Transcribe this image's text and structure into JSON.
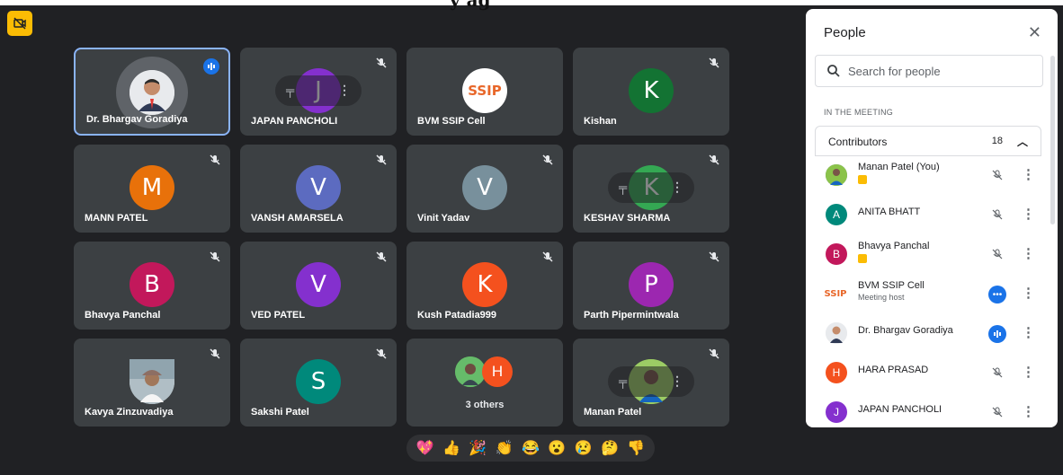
{
  "header_partial_text": "y ag",
  "tiles": [
    {
      "name": "Dr. Bhargav Goradiya"
    },
    {
      "name": "JAPAN PANCHOLI",
      "initial": "J",
      "color": "#8430ce"
    },
    {
      "name": "BVM SSIP Cell",
      "logo_text": "SSIP"
    },
    {
      "name": "Kishan",
      "initial": "K",
      "color": "#137333"
    },
    {
      "name": "MANN PATEL",
      "initial": "M",
      "color": "#e8710a"
    },
    {
      "name": "VANSH AMARSELA",
      "initial": "V",
      "color": "#5c6bc0"
    },
    {
      "name": "Vinit Yadav",
      "initial": "V",
      "color": "#78909c"
    },
    {
      "name": "KESHAV SHARMA",
      "initial": "K",
      "color": "#34a853"
    },
    {
      "name": "Bhavya Panchal",
      "initial": "B",
      "color": "#c2185b"
    },
    {
      "name": "VED PATEL",
      "initial": "V",
      "color": "#8430ce"
    },
    {
      "name": "Kush Patadia999",
      "initial": "K",
      "color": "#f4511e"
    },
    {
      "name": "Parth Pipermintwala",
      "initial": "P",
      "color": "#9c27b0"
    },
    {
      "name": "Kavya Zinzuvadiya"
    },
    {
      "name": "Sakshi Patel",
      "initial": "S",
      "color": "#00897b"
    },
    {
      "name": "3 others",
      "initial": "H",
      "color": "#f4511e"
    },
    {
      "name": "Manan Patel"
    }
  ],
  "reactions": [
    "💖",
    "👍",
    "🎉",
    "👏",
    "😂",
    "😮",
    "😢",
    "🤔",
    "👎"
  ],
  "panel": {
    "title": "People",
    "close": "✕",
    "search_placeholder": "Search for people",
    "section_label": "IN THE MEETING",
    "contributors_label": "Contributors",
    "contributors_count": "18",
    "people": [
      {
        "name": "Manan Patel (You)",
        "kind": "photo"
      },
      {
        "name": "ANITA BHATT",
        "initial": "A",
        "color": "#00897b"
      },
      {
        "name": "Bhavya Panchal",
        "initial": "B",
        "color": "#c2185b"
      },
      {
        "name": "BVM SSIP Cell",
        "sub": "Meeting host",
        "logo": "SSIP"
      },
      {
        "name": "Dr. Bhargav Goradiya",
        "kind": "photo"
      },
      {
        "name": "HARA PRASAD",
        "initial": "H",
        "color": "#f4511e"
      },
      {
        "name": "JAPAN PANCHOLI",
        "initial": "J",
        "color": "#8430ce"
      }
    ]
  }
}
